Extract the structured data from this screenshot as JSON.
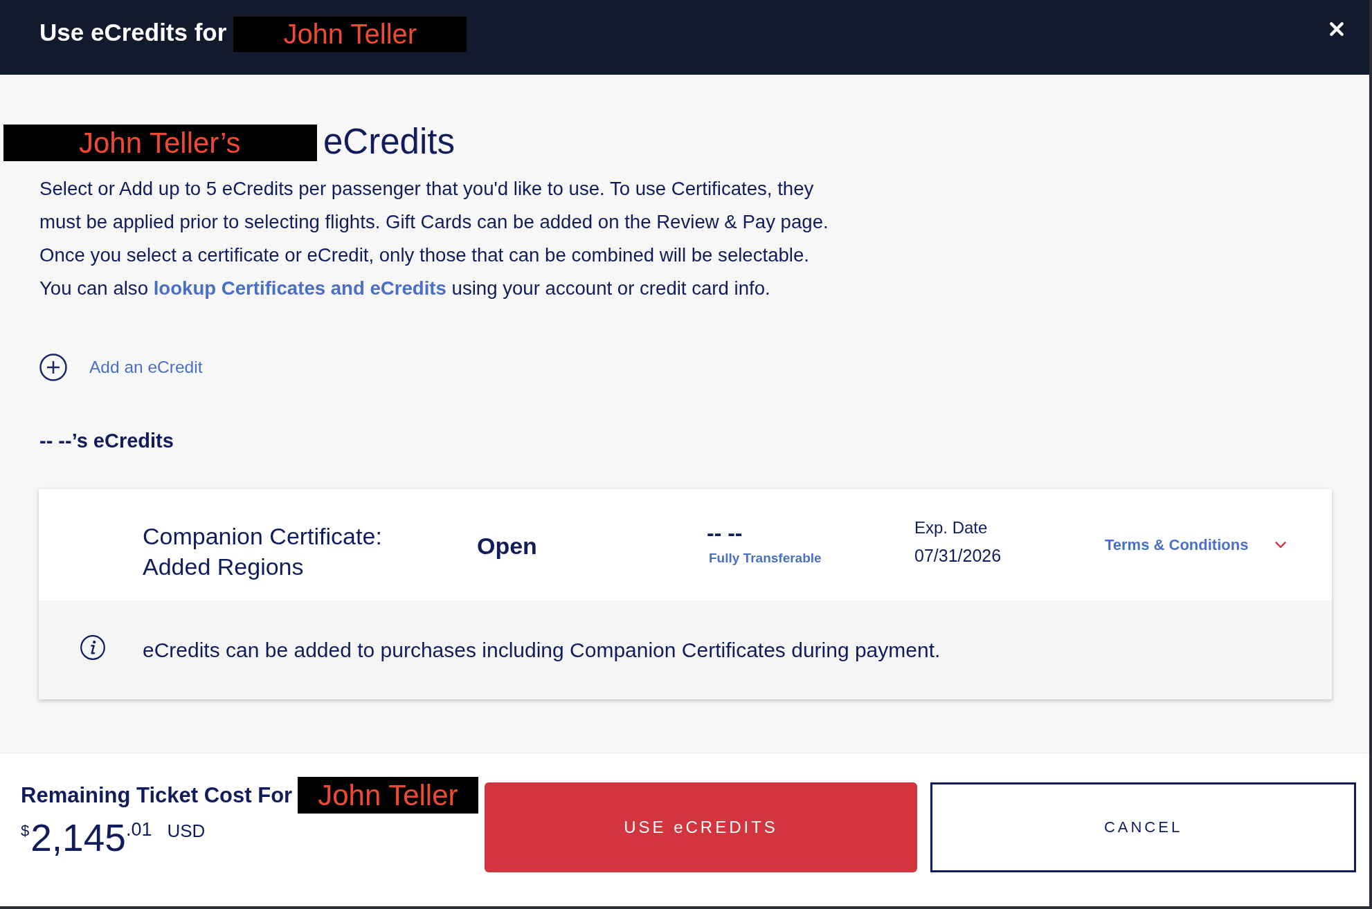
{
  "header": {
    "title": "Use eCredits for",
    "passenger_name": "John Teller"
  },
  "heading": {
    "passenger_name": "John Teller’s",
    "title": "eCredits"
  },
  "instructions": [
    {
      "kind": "text",
      "text": "Select or Add up to 5 eCredits per passenger that you'd like to use. To use Certificates, they must be applied prior to selecting flights. Gift Cards can be added on the Review & Pay page. Once you select a certificate or eCredit, only those that can be combined will be selectable. You can also "
    },
    {
      "kind": "link",
      "text": "lookup Certificates and eCredits"
    },
    {
      "kind": "text",
      "text": " using your account or credit card info."
    }
  ],
  "add_ecredit": {
    "label": "Add an eCredit"
  },
  "section_title": "-- --’s eCredits",
  "ecredits": [
    {
      "title": "Companion Certificate: Added Regions",
      "status": "Open",
      "holder": "-- --",
      "transferability": "Fully Transferable",
      "expiration_label": "Exp. Date",
      "expiration_date": "07/31/2026",
      "terms_link": "Terms & Conditions",
      "note": "eCredits can be added to purchases including Companion Certificates during payment."
    }
  ],
  "footer": {
    "label": "Remaining Ticket Cost For",
    "passenger_name": "John Teller",
    "price": {
      "currency_symbol": "$",
      "amount": "2,145",
      "cents": ".01",
      "currency": "USD"
    },
    "buttons": [
      {
        "kind": "primary",
        "label": "USE eCREDITS"
      },
      {
        "kind": "secondary",
        "label": "CANCEL"
      }
    ]
  }
}
